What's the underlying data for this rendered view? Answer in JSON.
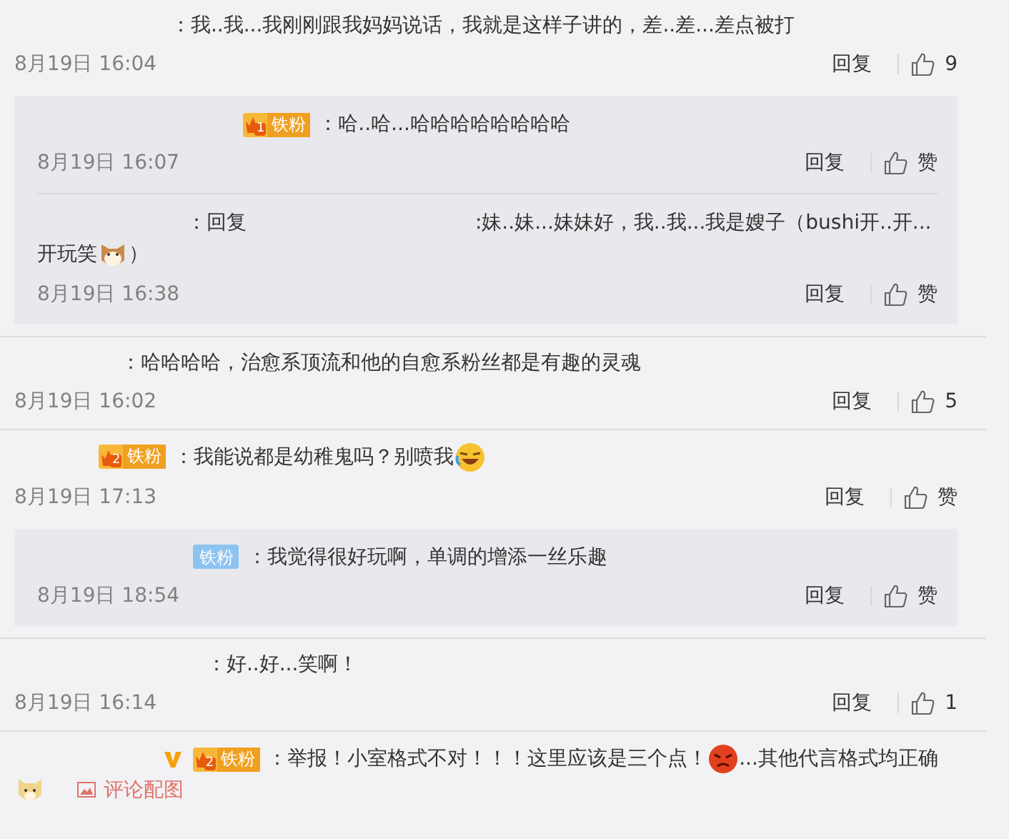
{
  "comments": [
    {
      "segments": [
        {
          "kind": "text",
          "text": "：我..我...我刚刚跟我妈妈说话，我就是这样子讲的，差..差...差点被打"
        }
      ],
      "time": "8月19日 16:04",
      "reply": "回复",
      "like": "9",
      "replies": [
        {
          "badge": {
            "kind": "crown",
            "level": "1",
            "label": "铁粉"
          },
          "segments": [
            {
              "kind": "text",
              "text": "：哈..哈...哈哈哈哈哈哈哈哈"
            }
          ],
          "time": "8月19日 16:07",
          "reply": "回复",
          "like": "赞"
        },
        {
          "segments": [
            {
              "kind": "text",
              "text": "：回复"
            },
            {
              "kind": "gap"
            },
            {
              "kind": "text",
              "text": ":妹..妹...妹妹好，我..我...我是嫂子（bushi开..开..."
            },
            {
              "kind": "text",
              "text": "开玩笑"
            },
            {
              "kind": "cat"
            },
            {
              "kind": "text",
              "text": "）"
            }
          ],
          "time": "8月19日 16:38",
          "reply": "回复",
          "like": "赞"
        }
      ]
    },
    {
      "segments": [
        {
          "kind": "text",
          "text": "：哈哈哈哈，治愈系顶流和他的自愈系粉丝都是有趣的灵魂"
        }
      ],
      "time": "8月19日 16:02",
      "reply": "回复",
      "like": "5"
    },
    {
      "badge": {
        "kind": "crown",
        "level": "2",
        "label": "铁粉"
      },
      "segments": [
        {
          "kind": "text",
          "text": "：我能说都是幼稚鬼吗？别喷我"
        },
        {
          "kind": "laugh"
        }
      ],
      "time": "8月19日 17:13",
      "reply": "回复",
      "like": "赞",
      "replies": [
        {
          "badge": {
            "kind": "plain",
            "label": "铁粉"
          },
          "segments": [
            {
              "kind": "text",
              "text": "：我觉得很好玩啊，单调的增添一丝乐趣"
            }
          ],
          "time": "8月19日 18:54",
          "reply": "回复",
          "like": "赞"
        }
      ]
    },
    {
      "segments": [
        {
          "kind": "text",
          "text": "：好..好...笑啊！"
        }
      ],
      "time": "8月19日 16:14",
      "reply": "回复",
      "like": "1"
    },
    {
      "verified": true,
      "badge": {
        "kind": "crown",
        "level": "2",
        "label": "铁粉"
      },
      "segments": [
        {
          "kind": "text",
          "text": "：举报！小室格式不对！！！这里应该是三个点！"
        },
        {
          "kind": "angry"
        },
        {
          "kind": "text",
          "text": "...其他代言格式"
        },
        {
          "kind": "text",
          "text": "均正确"
        },
        {
          "kind": "dog"
        }
      ],
      "attachment": "评论配图"
    }
  ]
}
